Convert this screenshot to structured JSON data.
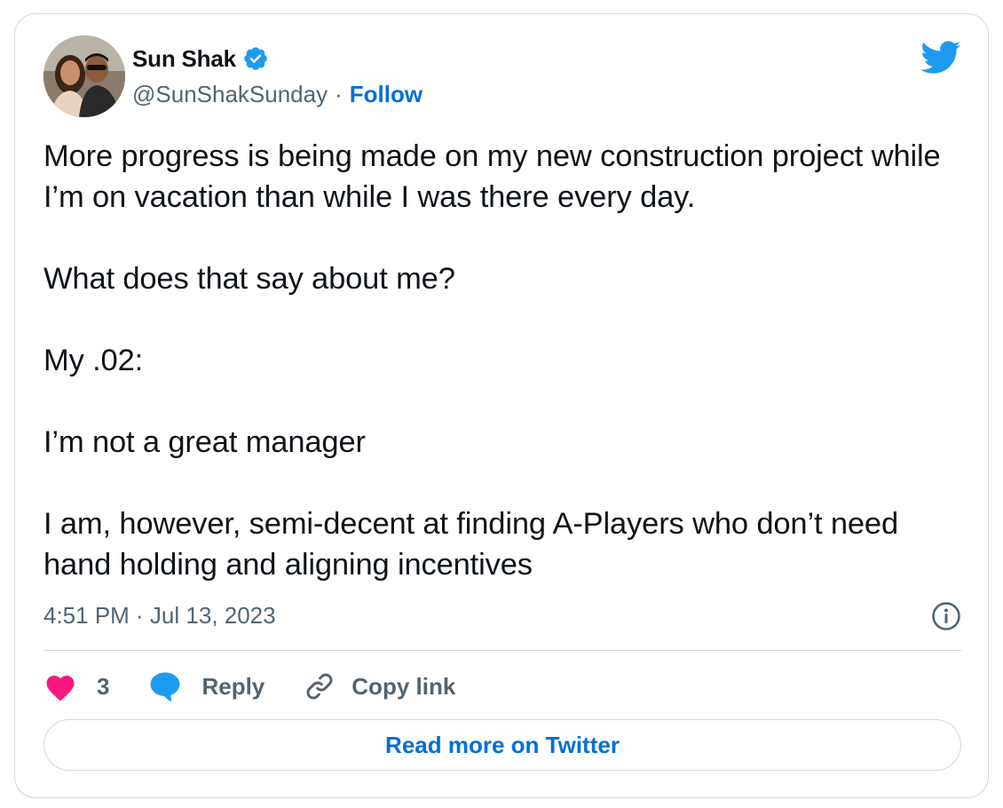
{
  "author": {
    "display_name": "Sun Shak",
    "handle": "@SunShakSunday",
    "separator": "·",
    "follow_label": "Follow",
    "verified": true
  },
  "tweet": {
    "paragraphs": [
      "More progress is being made on my new construction project while I’m on vacation than while I was there every day.",
      "What does that say about me?",
      "My .02:",
      "I’m not a great manager",
      "I am, however, semi-decent at finding A-Players who don’t need hand holding and aligning incentives"
    ],
    "timestamp": "4:51 PM · Jul 13, 2023"
  },
  "actions": {
    "like_count": "3",
    "reply_label": "Reply",
    "copy_link_label": "Copy link"
  },
  "read_more_label": "Read more on Twitter",
  "colors": {
    "accent_blue": "#1d9bf0",
    "link_blue": "#006fd6",
    "heart_pink": "#f91880",
    "secondary_text": "#536471",
    "border": "#cfd9de"
  },
  "icons": {
    "verified": "verified-badge-icon",
    "brand": "twitter-bird-icon",
    "info": "info-icon",
    "like": "heart-icon",
    "reply": "speech-bubble-icon",
    "copy": "link-icon"
  }
}
